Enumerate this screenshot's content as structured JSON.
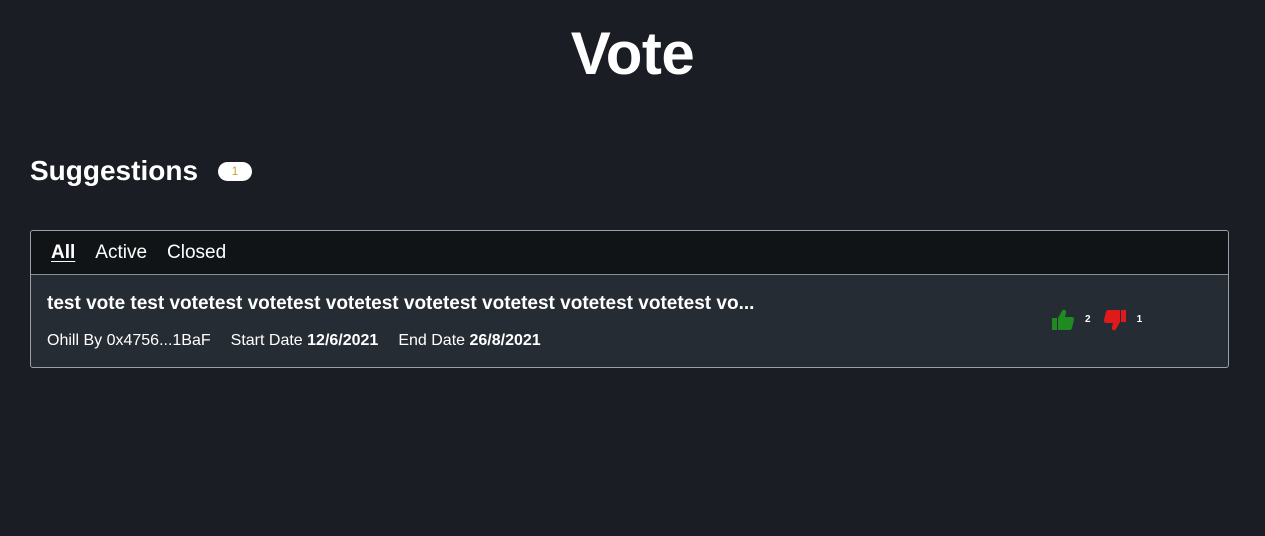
{
  "header": {
    "title": "Vote"
  },
  "suggestions": {
    "title": "Suggestions",
    "count": "1"
  },
  "tabs": [
    {
      "label": "All",
      "active": true
    },
    {
      "label": "Active",
      "active": false
    },
    {
      "label": "Closed",
      "active": false
    }
  ],
  "items": [
    {
      "title": "test vote test votetest votetest votetest votetest votetest votetest votetest vo...",
      "author_prefix": "Ohill By",
      "author": "0x4756...1BaF",
      "start_label": "Start Date",
      "start_date": "12/6/2021",
      "end_label": "End Date",
      "end_date": "26/8/2021",
      "upvotes": "2",
      "downvotes": "1",
      "upvote_icon": "thumbs-up-icon",
      "downvote_icon": "thumbs-down-icon"
    }
  ],
  "colors": {
    "background": "#1a1d24",
    "panel": "#262c33",
    "tabs_bar": "#111416",
    "upvote": "#1f8a1f",
    "downvote": "#e01a1a",
    "badge_text": "#c9a23a"
  }
}
